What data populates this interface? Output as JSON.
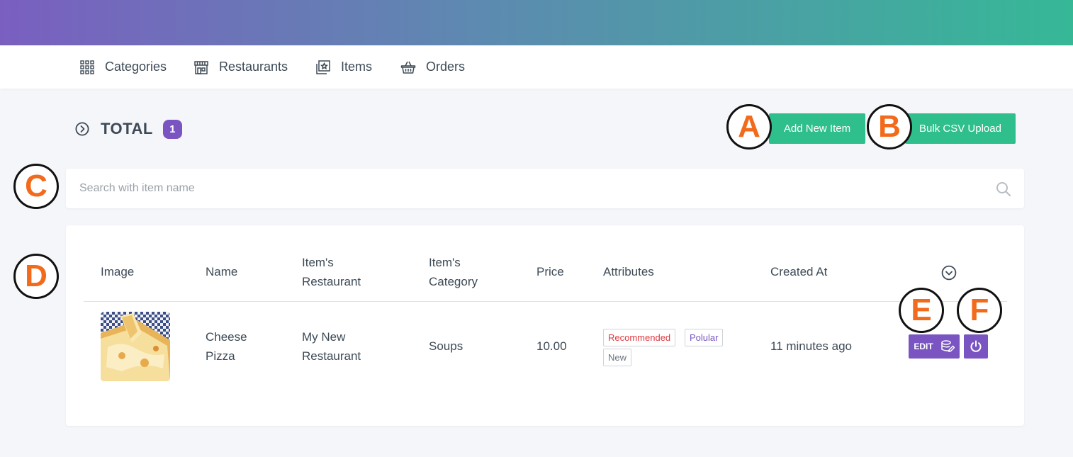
{
  "nav": {
    "items": [
      {
        "label": "Categories",
        "icon": "grid-icon"
      },
      {
        "label": "Restaurants",
        "icon": "store-icon"
      },
      {
        "label": "Items",
        "icon": "image-icon"
      },
      {
        "label": "Orders",
        "icon": "basket-icon"
      }
    ]
  },
  "header": {
    "total_label": "TOTAL",
    "total_count": "1",
    "add_button": "Add New Item",
    "bulk_button": "Bulk CSV Upload"
  },
  "search": {
    "placeholder": "Search with item name"
  },
  "table": {
    "columns": [
      "Image",
      "Name",
      "Item's\nRestaurant",
      "Item's\nCategory",
      "Price",
      "Attributes",
      "Created At"
    ],
    "rows": [
      {
        "name": "Cheese\nPizza",
        "restaurant": "My New\nRestaurant",
        "category": "Soups",
        "price": "10.00",
        "attributes": [
          {
            "label": "Recommended",
            "color": "#e0383e"
          },
          {
            "label": "Polular",
            "color": "#7a55c2"
          },
          {
            "label": "New",
            "color": "#6c757d"
          }
        ],
        "created_at": "11 minutes ago",
        "edit_label": "EDIT"
      }
    ]
  },
  "callouts": [
    "A",
    "B",
    "C",
    "D",
    "E",
    "F"
  ],
  "colors": {
    "accent_purple": "#7a55c2",
    "accent_green": "#2fbf8c",
    "callout_orange": "#f26a1b"
  }
}
